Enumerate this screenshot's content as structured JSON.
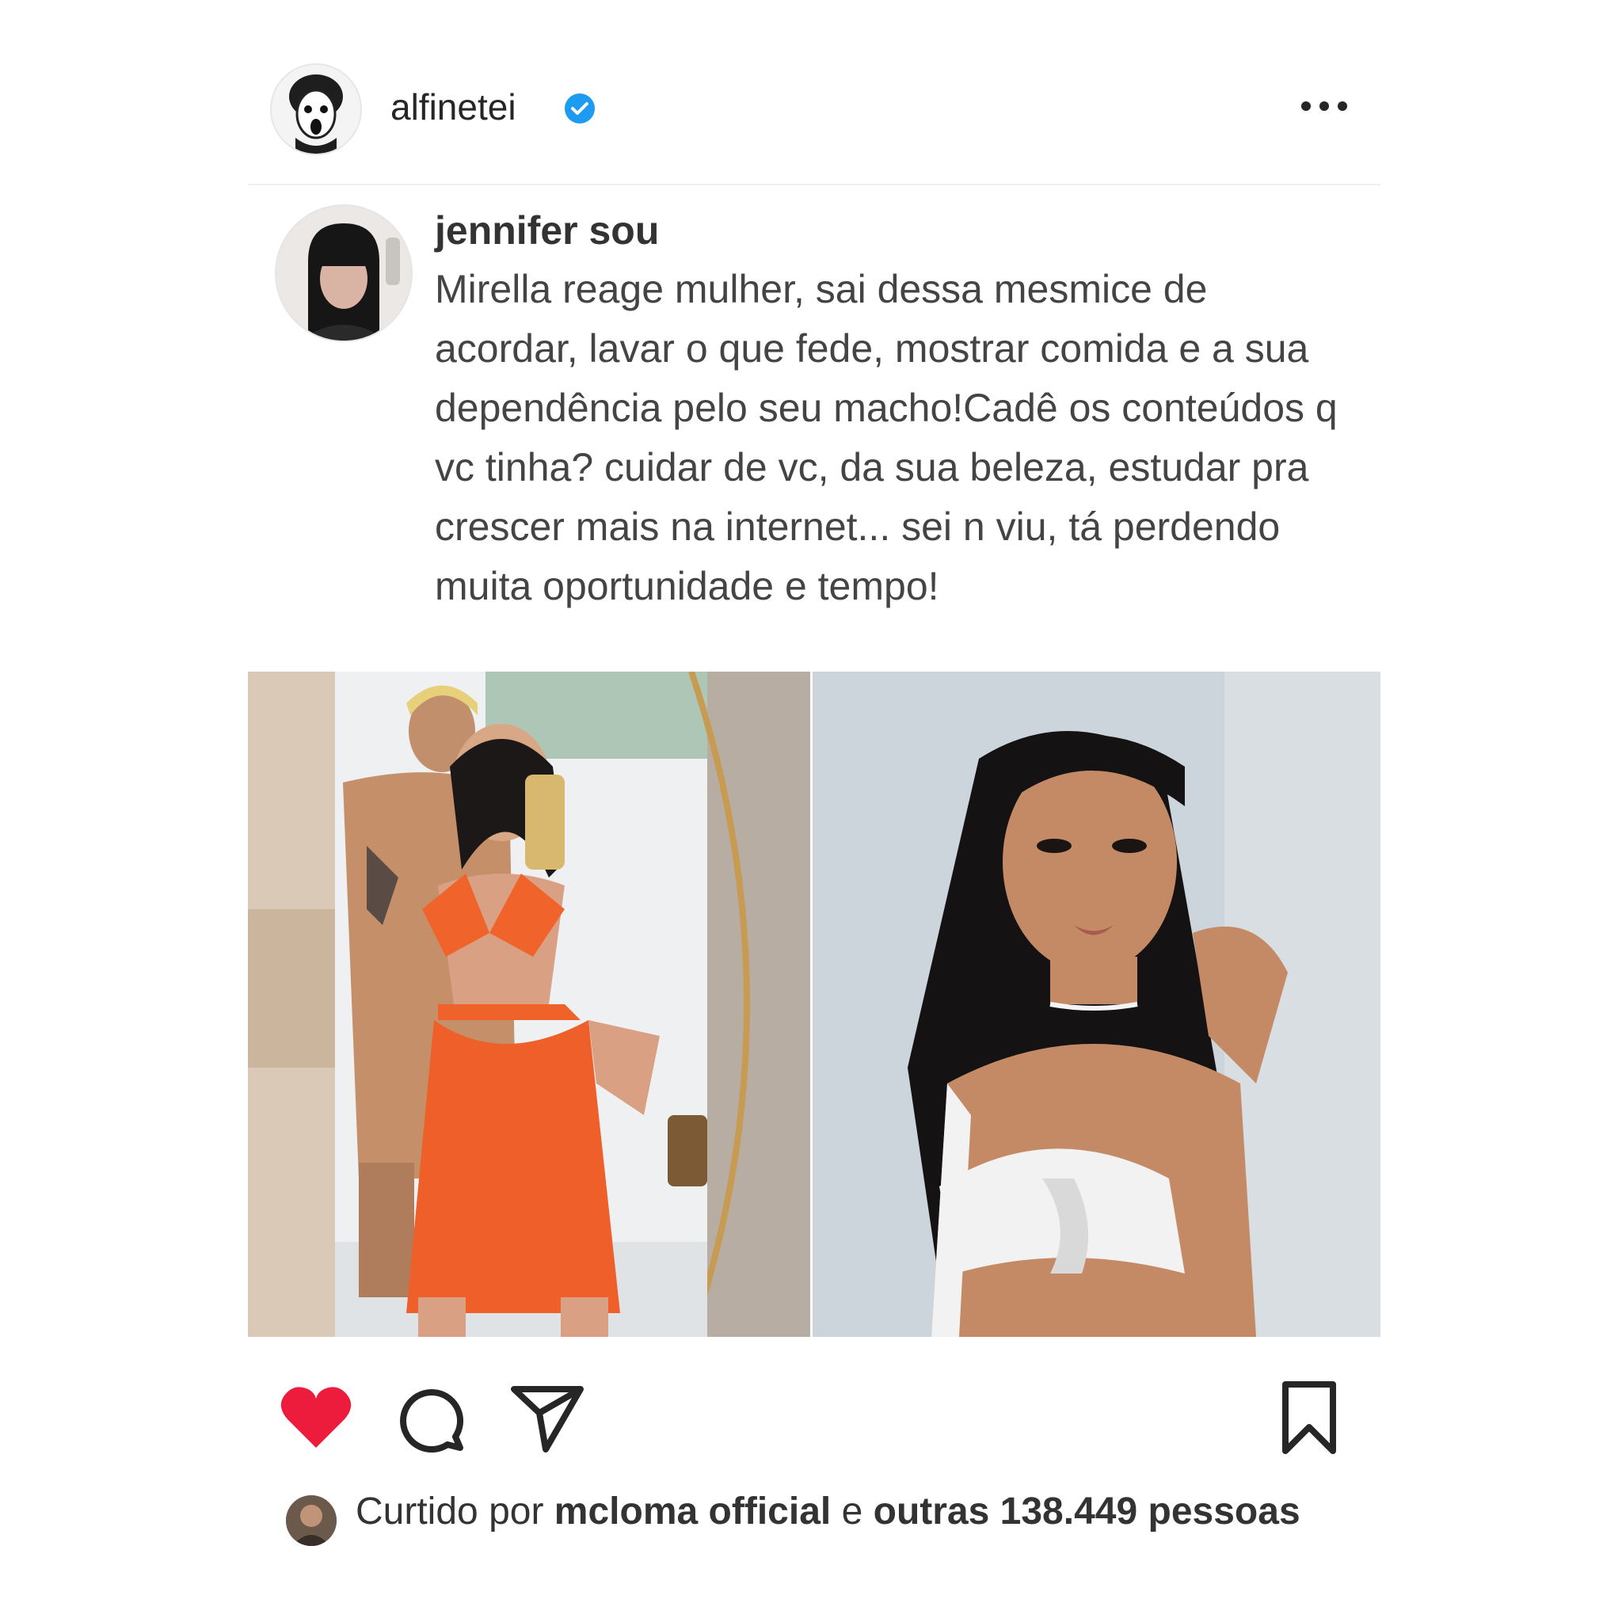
{
  "post": {
    "account": {
      "username": "alfinetei",
      "verified": true,
      "avatar_icon": "avatar-cartoon-icon",
      "more_icon": "more-options-icon"
    },
    "quote": {
      "author": "jennifer sou",
      "avatar_icon": "avatar-photo-icon",
      "text": "Mirella reage mulher, sai dessa mesmice de acordar, lavar o que fede, mostrar comida e a sua dependência pelo seu macho!Cadê os conteúdos q vc tinha? cuidar de vc, da sua beleza, estudar pra crescer mais na internet... sei n viu, tá perdendo muita oportunidade e tempo!"
    },
    "images": [
      {
        "icon": "photo-couple-mirror-selfie"
      },
      {
        "icon": "photo-woman-selfie"
      }
    ],
    "actions": {
      "like_icon": "heart-filled-icon",
      "comment_icon": "comment-icon",
      "share_icon": "send-icon",
      "save_icon": "bookmark-icon"
    },
    "likes": {
      "prefix": "Curtido por",
      "user": "mcloma official",
      "connector": "e",
      "others": "outras 138.449",
      "suffix": "pessoas"
    }
  },
  "colors": {
    "like_red": "#ed1c3c",
    "verified_blue": "#1d9bf0",
    "text": "#262626"
  }
}
